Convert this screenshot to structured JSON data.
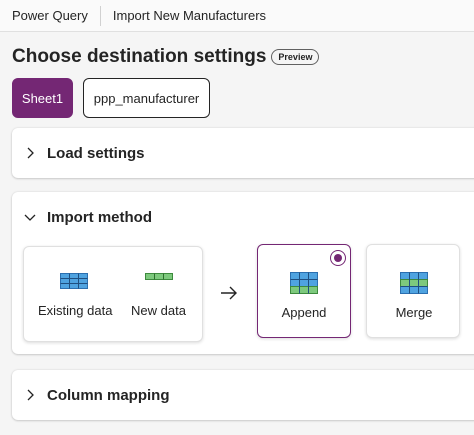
{
  "breadcrumb": {
    "app": "Power Query",
    "page": "Import New Manufacturers"
  },
  "header": {
    "title": "Choose destination settings",
    "badge": "Preview"
  },
  "sheet_tabs": [
    {
      "label": "Sheet1",
      "selected": true
    },
    {
      "label": "ppp_manufacturer",
      "selected": false
    }
  ],
  "sections": {
    "load_settings": {
      "title": "Load settings",
      "expanded": false
    },
    "import_method": {
      "title": "Import method",
      "expanded": true
    },
    "column_mapping": {
      "title": "Column mapping",
      "expanded": false
    }
  },
  "import_method": {
    "source_labels": {
      "existing": "Existing data",
      "new": "New data"
    },
    "arrow_icon": "arrow-right-icon",
    "options": [
      {
        "label": "Append",
        "selected": true
      },
      {
        "label": "Merge",
        "selected": false
      }
    ]
  },
  "colors": {
    "accent": "#742774",
    "table_blue": "#4fa3e0",
    "table_green": "#7dc97d"
  }
}
